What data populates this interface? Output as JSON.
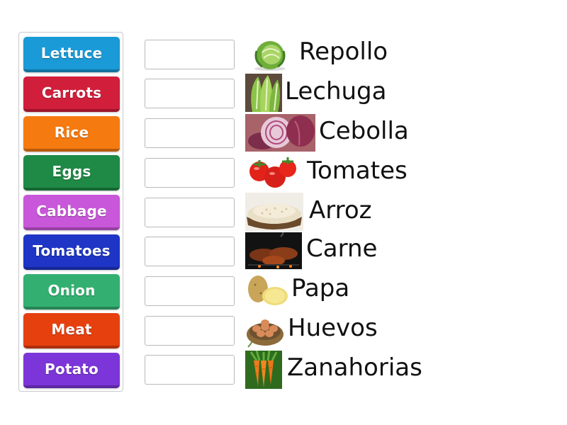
{
  "tiles": [
    {
      "label": "Lettuce",
      "color": "#1a9ad6"
    },
    {
      "label": "Carrots",
      "color": "#d11e3a"
    },
    {
      "label": "Rice",
      "color": "#f57a10"
    },
    {
      "label": "Eggs",
      "color": "#1e8a45"
    },
    {
      "label": "Cabbage",
      "color": "#c857d9"
    },
    {
      "label": "Tomatoes",
      "color": "#1f35c6"
    },
    {
      "label": "Onion",
      "color": "#33b071"
    },
    {
      "label": "Meat",
      "color": "#e6400f"
    },
    {
      "label": "Potato",
      "color": "#7c35d9"
    }
  ],
  "rows": [
    {
      "word": "Repollo",
      "image_icon": "cabbage-image"
    },
    {
      "word": "Lechuga",
      "image_icon": "lettuce-image"
    },
    {
      "word": "Cebolla",
      "image_icon": "onion-image"
    },
    {
      "word": "Tomates",
      "image_icon": "tomatoes-image"
    },
    {
      "word": "Arroz",
      "image_icon": "rice-image"
    },
    {
      "word": "Carne",
      "image_icon": "meat-image"
    },
    {
      "word": "Papa",
      "image_icon": "potato-image"
    },
    {
      "word": "Huevos",
      "image_icon": "eggs-image"
    },
    {
      "word": "Zanahorias",
      "image_icon": "carrots-image"
    }
  ]
}
